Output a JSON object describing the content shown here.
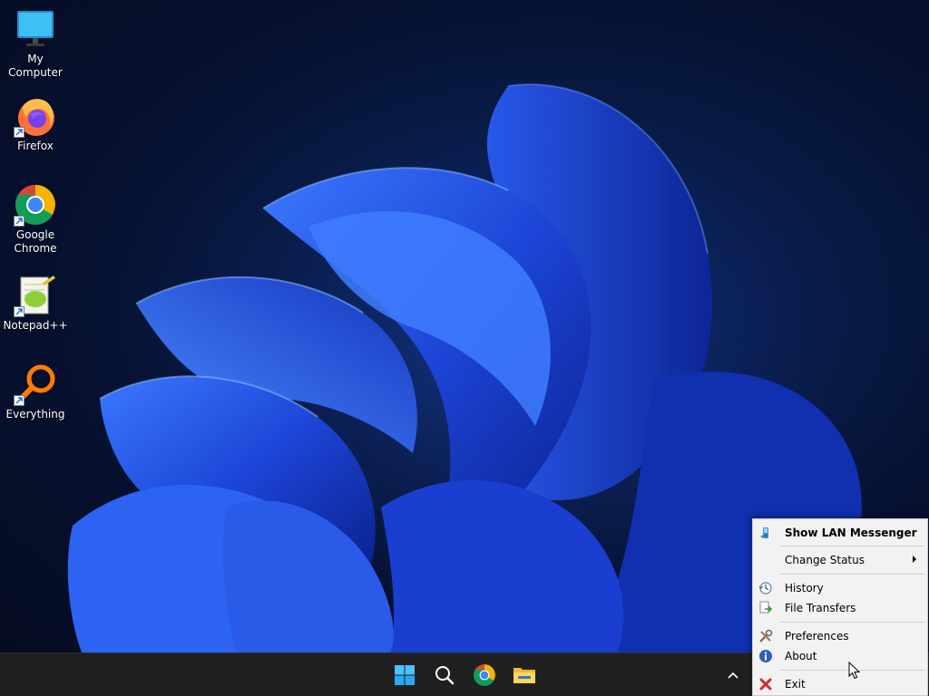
{
  "desktop": {
    "icons": [
      {
        "label": "My Computer",
        "icon": "monitor-icon"
      },
      {
        "label": "Firefox",
        "icon": "firefox-icon"
      },
      {
        "label": "Google\nChrome",
        "icon": "chrome-icon"
      },
      {
        "label": "Notepad++",
        "icon": "notepadpp-icon"
      },
      {
        "label": "Everything",
        "icon": "everything-search-icon"
      }
    ]
  },
  "taskbar": {
    "items": [
      "start-windows-icon",
      "search-icon",
      "chrome-icon",
      "file-explorer-icon"
    ],
    "tray_chevron": "chevron-up-icon"
  },
  "context_menu": {
    "items": [
      {
        "label": "Show LAN Messenger",
        "icon": "lan-messenger-icon",
        "bold": true
      },
      {
        "label": "Change Status",
        "submenu": true
      },
      {
        "label": "History",
        "icon": "history-icon"
      },
      {
        "label": "File Transfers",
        "icon": "file-transfer-icon"
      },
      {
        "label": "Preferences",
        "icon": "tools-icon"
      },
      {
        "label": "About",
        "icon": "info-icon"
      },
      {
        "label": "Exit",
        "icon": "red-x-icon"
      }
    ]
  },
  "colors": {
    "desktop_bg": "#061130",
    "bloom_blue": "#1f4fe0",
    "taskbar_bg": "#202020",
    "menu_bg": "#f2f2f2"
  }
}
